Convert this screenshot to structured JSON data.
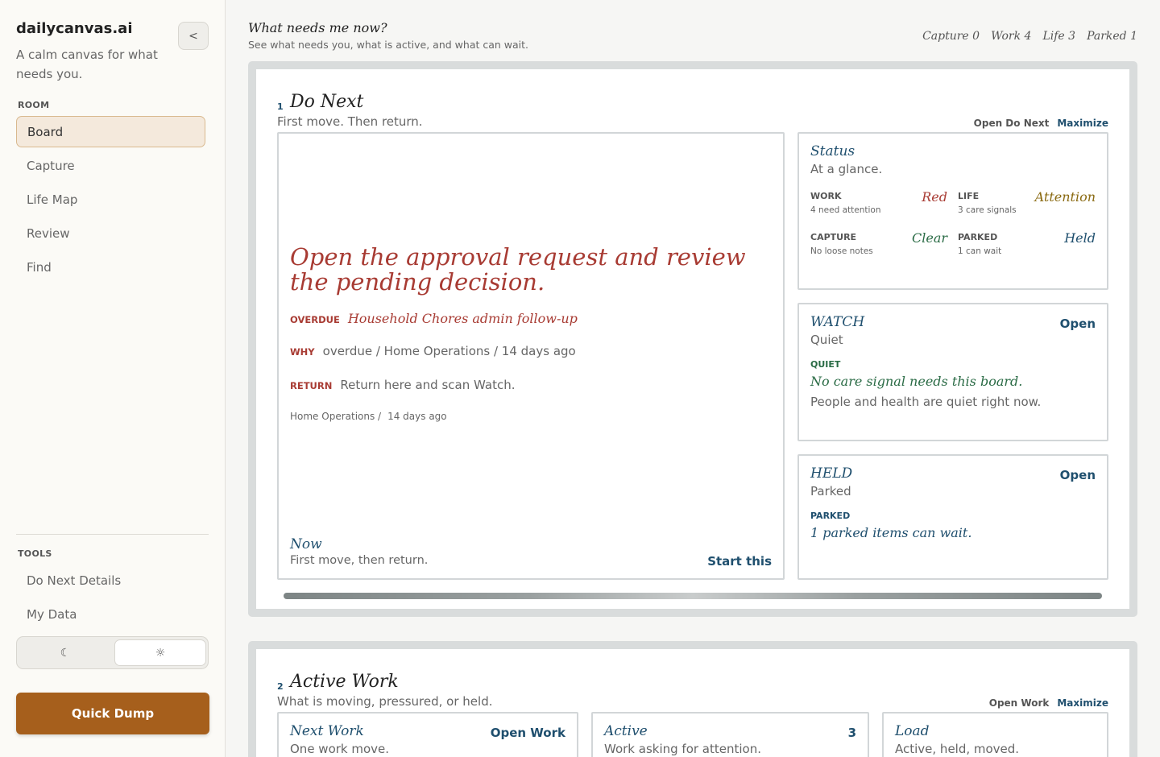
{
  "sidebar": {
    "brand": "dailycanvas.ai",
    "tagline": "A calm canvas for what needs you.",
    "collapse_label": "<",
    "room_label": "ROOM",
    "room_items": [
      {
        "label": "Board",
        "active": true
      },
      {
        "label": "Capture",
        "active": false
      },
      {
        "label": "Life Map",
        "active": false
      },
      {
        "label": "Review",
        "active": false
      },
      {
        "label": "Find",
        "active": false
      }
    ],
    "tools_label": "TOOLS",
    "tool_items": [
      {
        "label": "Do Next Details"
      },
      {
        "label": "My Data"
      }
    ],
    "theme": {
      "dark_icon": "☾",
      "light_icon": "☼",
      "selected": "light"
    },
    "quick_dump": "Quick Dump"
  },
  "header": {
    "title": "What needs me now?",
    "subtitle": "See what needs you, what is active, and what can wait.",
    "counts": [
      {
        "label": "Capture 0"
      },
      {
        "label": "Work 4"
      },
      {
        "label": "Life 3"
      },
      {
        "label": "Parked 1"
      }
    ]
  },
  "do_next": {
    "number": "1",
    "title": "Do Next",
    "subtitle": "First move. Then return.",
    "open_label": "Open Do Next",
    "maximize_label": "Maximize",
    "task": {
      "title": "Open the approval request and review the pending decision.",
      "overdue_key": "OVERDUE",
      "overdue_val": "Household Chores admin follow-up",
      "why_key": "WHY",
      "why_val": "overdue / Home Operations / 14 days ago",
      "return_key": "RETURN",
      "return_val": "Return here and scan Watch.",
      "crumb_area": "Home Operations /",
      "crumb_time": "14 days ago",
      "now_title": "Now",
      "now_sub": "First move, then return.",
      "start_label": "Start this"
    },
    "status": {
      "title": "Status",
      "subtitle": "At a glance.",
      "work_key": "WORK",
      "work_desc": "4 need attention",
      "work_val": "Red",
      "work_color": "#a83b33",
      "life_key": "LIFE",
      "life_desc": "3 care signals",
      "life_val": "Attention",
      "life_color": "#8a6a12",
      "capture_key": "CAPTURE",
      "capture_desc": "No loose notes",
      "capture_val": "Clear",
      "capture_color": "#2a6b45",
      "parked_key": "PARKED",
      "parked_desc": "1 can wait",
      "parked_val": "Held",
      "parked_color": "#1f4f6e"
    },
    "watch": {
      "title": "WATCH",
      "subtitle": "Quiet",
      "open_label": "Open",
      "tag": "QUIET",
      "headline": "No care signal needs this board.",
      "body": "People and health are quiet right now."
    },
    "held": {
      "title": "HELD",
      "subtitle": "Parked",
      "open_label": "Open",
      "tag": "PARKED",
      "headline": "1 parked items can wait."
    }
  },
  "active_work": {
    "number": "2",
    "title": "Active Work",
    "subtitle": "What is moving, pressured, or held.",
    "open_label": "Open Work",
    "maximize_label": "Maximize",
    "cards": [
      {
        "title": "Next Work",
        "sub": "One work move.",
        "action": "Open Work"
      },
      {
        "title": "Active",
        "sub": "Work asking for attention.",
        "action": "3"
      },
      {
        "title": "Load",
        "sub": "Active, held, moved.",
        "action": ""
      }
    ]
  }
}
